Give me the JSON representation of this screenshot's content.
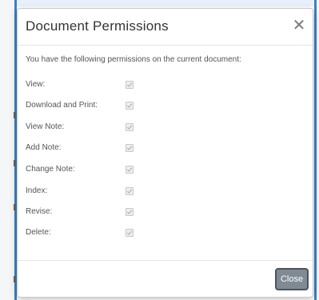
{
  "dialog": {
    "title": "Document Permissions",
    "close_icon": "close-icon",
    "intro": "You have the following permissions on the current document:",
    "permissions": [
      {
        "label": "View:",
        "checked": true
      },
      {
        "label": "Download and Print:",
        "checked": true
      },
      {
        "label": "View Note:",
        "checked": true
      },
      {
        "label": "Add Note:",
        "checked": true
      },
      {
        "label": "Change Note:",
        "checked": true
      },
      {
        "label": "Index:",
        "checked": true
      },
      {
        "label": "Revise:",
        "checked": true
      },
      {
        "label": "Delete:",
        "checked": true
      }
    ],
    "close_button_label": "Close"
  },
  "colors": {
    "close_button_bg": "#7f8a93",
    "checkbox_disabled": "#eeeeee",
    "accent_edge": "#3b82c4"
  }
}
